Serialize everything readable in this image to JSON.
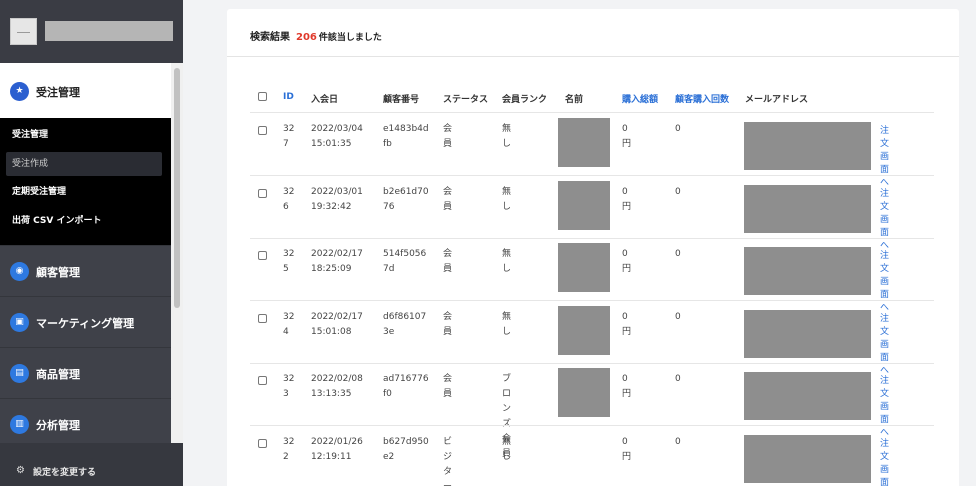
{
  "sidebar": {
    "order_section": {
      "label": "受注管理",
      "icon": "star-icon"
    },
    "submenu": [
      {
        "label": "受注管理",
        "active": false
      },
      {
        "label": "受注作成",
        "active": true
      },
      {
        "label": "定期受注管理",
        "active": false
      },
      {
        "label": "出荷 CSV インポート",
        "active": false
      }
    ],
    "sections": [
      {
        "label": "顧客管理",
        "icon": "user-icon"
      },
      {
        "label": "マーケティング管理",
        "icon": "megaphone-icon"
      },
      {
        "label": "商品管理",
        "icon": "box-icon"
      },
      {
        "label": "分析管理",
        "icon": "chart-icon"
      }
    ],
    "footer": {
      "label": "設定を変更する",
      "icon": "gear-icon"
    }
  },
  "results": {
    "prefix": "検索結果",
    "count": "206",
    "suffix": "件該当しました"
  },
  "table": {
    "headers": [
      "ID",
      "入会日",
      "顧客番号",
      "ステータス",
      "会員ランク",
      "名前",
      "購入総額",
      "顧客購入回数",
      "メールアドレス"
    ],
    "link_label": "注文画面へ",
    "rows": [
      {
        "id": [
          "32",
          "7"
        ],
        "date": [
          "2022/03/04",
          "15:01:35"
        ],
        "cust": [
          "e1483b4d",
          "fb"
        ],
        "status": "会員",
        "rank": [
          "無し"
        ],
        "total": "0円",
        "count": "0"
      },
      {
        "id": [
          "32",
          "6"
        ],
        "date": [
          "2022/03/01",
          "19:32:42"
        ],
        "cust": [
          "b2e61d70",
          "76"
        ],
        "status": "会員",
        "rank": [
          "無し"
        ],
        "total": "0円",
        "count": "0"
      },
      {
        "id": [
          "32",
          "5"
        ],
        "date": [
          "2022/02/17",
          "18:25:09"
        ],
        "cust": [
          "514f5056",
          "7d"
        ],
        "status": "会員",
        "rank": [
          "無し"
        ],
        "total": "0円",
        "count": "0"
      },
      {
        "id": [
          "32",
          "4"
        ],
        "date": [
          "2022/02/17",
          "15:01:08"
        ],
        "cust": [
          "d6f86107",
          "3e"
        ],
        "status": "会員",
        "rank": [
          "無し"
        ],
        "total": "0円",
        "count": "0"
      },
      {
        "id": [
          "32",
          "3"
        ],
        "date": [
          "2022/02/08",
          "13:13:35"
        ],
        "cust": [
          "ad716776",
          "f0"
        ],
        "status": "会員",
        "rank": [
          "ブロンズ会",
          "員"
        ],
        "total": "0円",
        "count": "0"
      },
      {
        "id": [
          "32",
          "2"
        ],
        "date": [
          "2022/01/26",
          "12:19:11"
        ],
        "cust": [
          "b627d950",
          "e2"
        ],
        "status": "ビジター",
        "rank": [
          "無し"
        ],
        "total": "0円",
        "count": "0"
      }
    ]
  },
  "colors": {
    "accent": "#2a6fd6",
    "count": "#e0392b",
    "sidebar": "#3f4149"
  }
}
